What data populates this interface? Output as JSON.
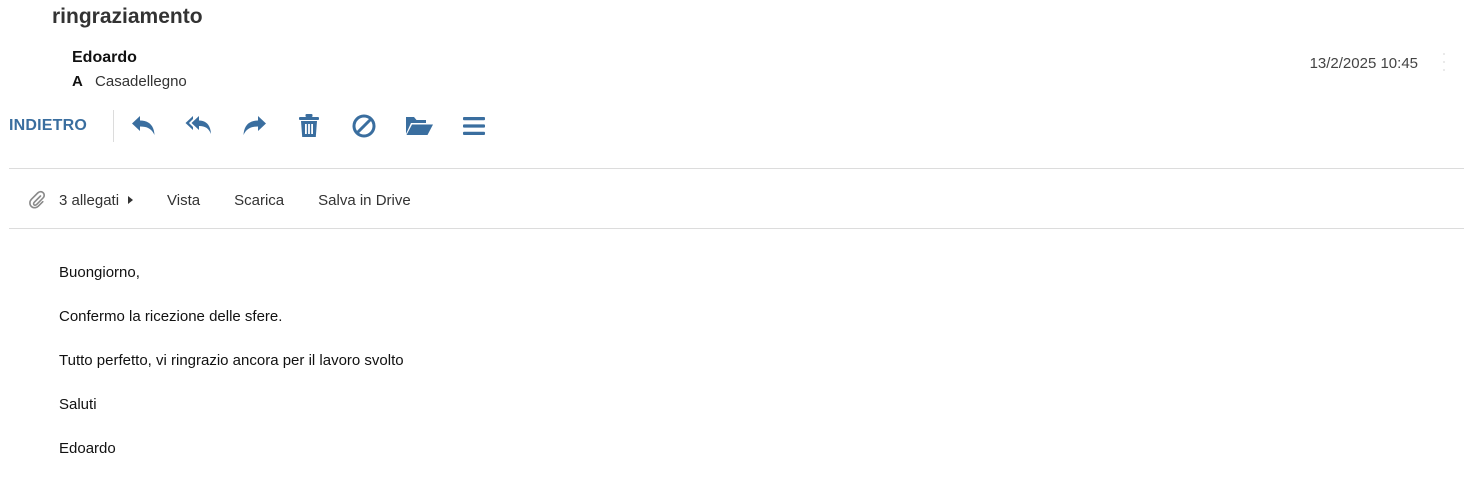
{
  "message": {
    "subject": "ringraziamento",
    "sender": "Edoardo",
    "to_label": "A",
    "to_name": "Casadellegno",
    "date": "13/2/2025 10:45"
  },
  "toolbar": {
    "back_label": "INDIETRO",
    "accent_color": "#3a6e9f",
    "icons": [
      "reply-icon",
      "reply-all-icon",
      "forward-icon",
      "trash-icon",
      "block-icon",
      "folder-open-icon",
      "menu-icon"
    ]
  },
  "attachments": {
    "count_label": "3 allegati",
    "view_label": "Vista",
    "download_label": "Scarica",
    "save_drive_label": "Salva in Drive"
  },
  "body": {
    "lines": [
      "Buongiorno,",
      "Confermo la ricezione delle sfere.",
      "Tutto perfetto, vi ringrazio ancora per il lavoro svolto",
      "Saluti",
      "Edoardo"
    ]
  }
}
